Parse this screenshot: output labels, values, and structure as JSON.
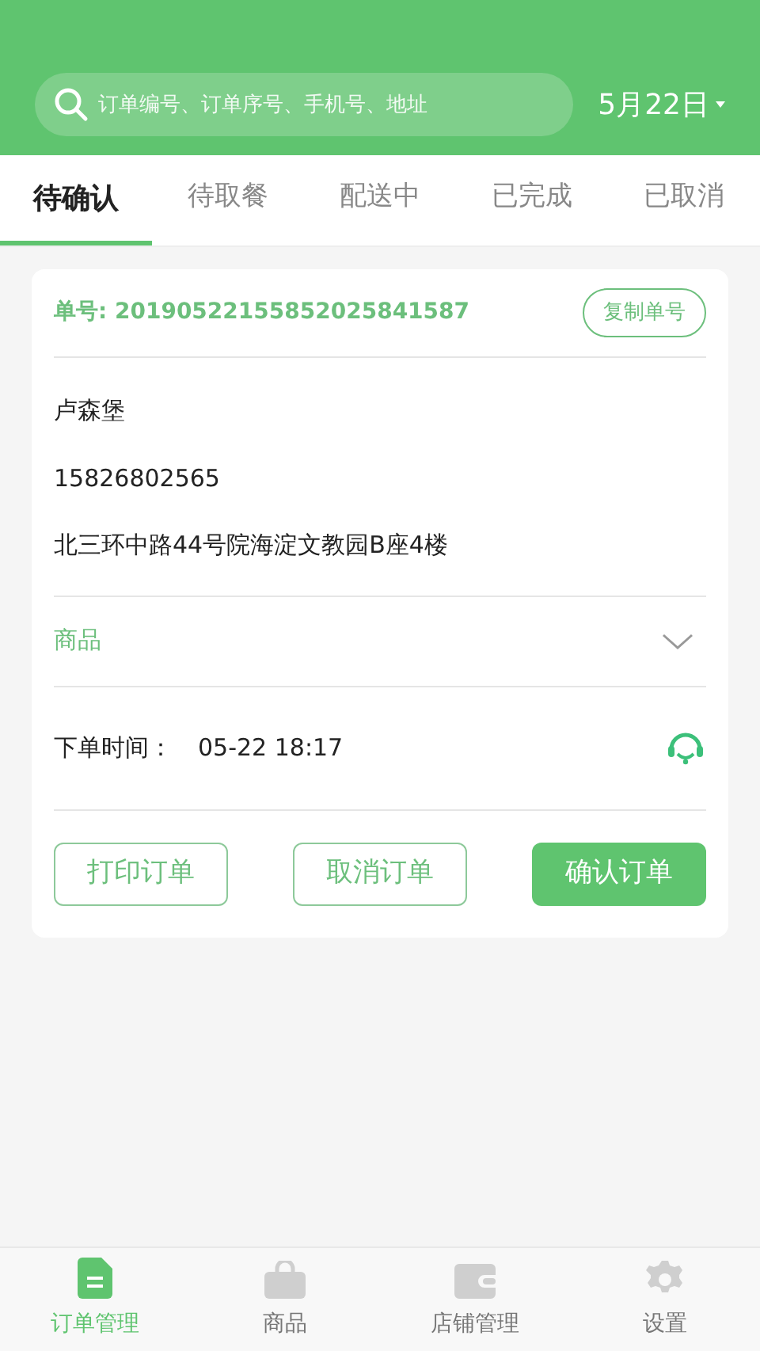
{
  "header": {
    "search": {
      "placeholder": "订单编号、订单序号、手机号、地址"
    },
    "date": "5月22日"
  },
  "tabs": [
    {
      "label": "待确认",
      "selected": true
    },
    {
      "label": "待取餐",
      "selected": false
    },
    {
      "label": "配送中",
      "selected": false
    },
    {
      "label": "已完成",
      "selected": false
    },
    {
      "label": "已取消",
      "selected": false
    }
  ],
  "order": {
    "number_label": "单号: 20190522155852025841587",
    "copy_button": "复制单号",
    "name": "卢森堡",
    "phone": "15826802565",
    "address": "北三环中路44号院海淀文教园B座4楼",
    "goods_label": "商品",
    "expanded": false,
    "time_label": "下单时间：",
    "time": "05-22 18:17",
    "buttons": [
      {
        "label": "打印订单",
        "kind": "outline"
      },
      {
        "label": "取消订单",
        "kind": "outline"
      },
      {
        "label": "确认订单",
        "kind": "filled"
      }
    ]
  },
  "bottom_nav": [
    {
      "label": "订单管理",
      "selected": true
    },
    {
      "label": "商品",
      "selected": false
    },
    {
      "label": "店铺管理",
      "selected": false
    },
    {
      "label": "设置",
      "selected": false
    }
  ]
}
